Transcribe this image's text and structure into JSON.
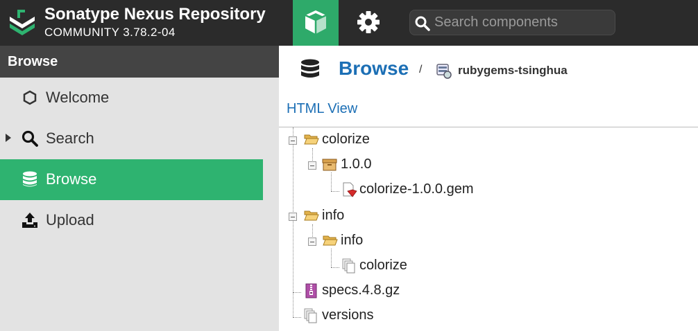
{
  "header": {
    "title": "Sonatype Nexus Repository",
    "version": "COMMUNITY 3.78.2-04",
    "search_placeholder": "Search components",
    "accent": "#2eaa6a"
  },
  "sidebar": {
    "title": "Browse",
    "items": [
      {
        "label": "Welcome",
        "icon": "hexagon-icon"
      },
      {
        "label": "Search",
        "icon": "search-icon"
      },
      {
        "label": "Browse",
        "icon": "database-icon",
        "active": true
      },
      {
        "label": "Upload",
        "icon": "upload-icon"
      }
    ]
  },
  "main": {
    "title": "Browse",
    "separator": "/",
    "repository": "rubygems-tsinghua",
    "html_view": "HTML View"
  },
  "tree": [
    {
      "label": "colorize",
      "icon": "folder-open-icon"
    },
    {
      "label": "1.0.0",
      "icon": "package-icon"
    },
    {
      "label": "colorize-1.0.0.gem",
      "icon": "ruby-gem-file-icon"
    },
    {
      "label": "info",
      "icon": "folder-open-icon"
    },
    {
      "label": "info",
      "icon": "folder-open-icon"
    },
    {
      "label": "colorize",
      "icon": "file-stack-icon"
    },
    {
      "label": "specs.4.8.gz",
      "icon": "archive-file-icon"
    },
    {
      "label": "versions",
      "icon": "file-stack-icon"
    }
  ]
}
